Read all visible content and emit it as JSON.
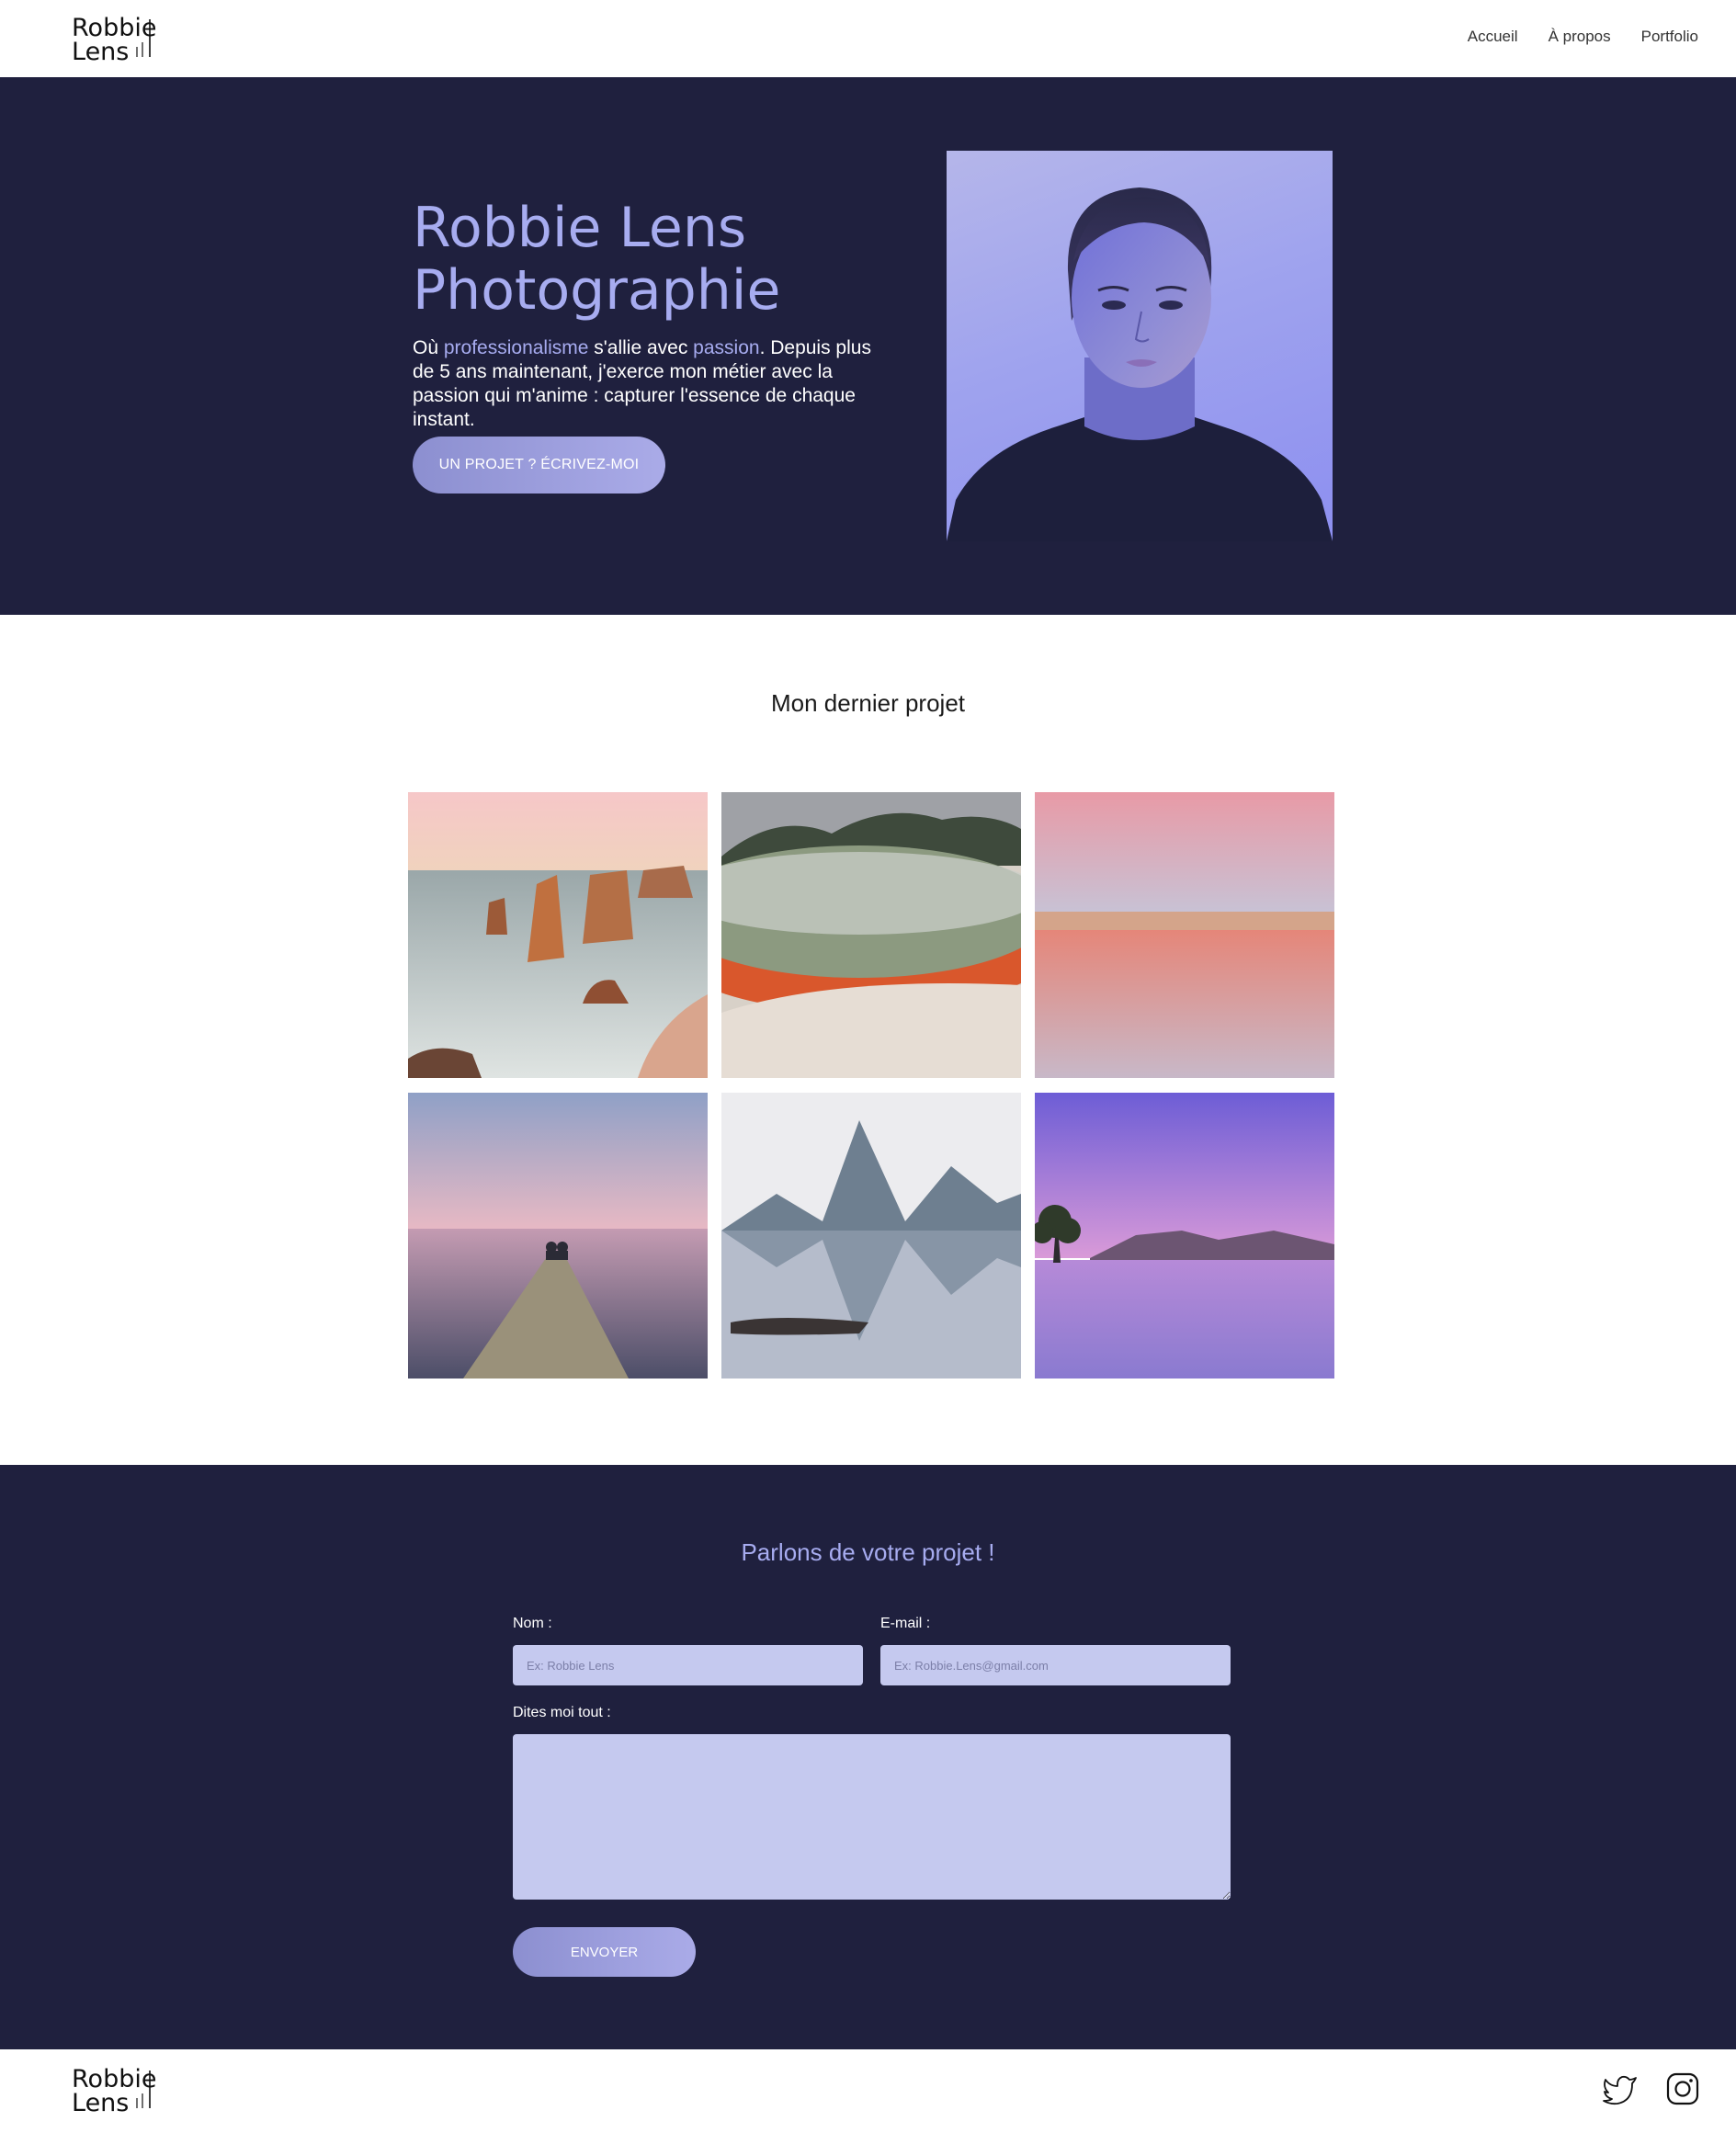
{
  "brand": {
    "line1": "Robbie",
    "line2": "Lens"
  },
  "nav": {
    "home": "Accueil",
    "about": "À propos",
    "portfolio": "Portfolio"
  },
  "hero": {
    "title_line1": "Robbie Lens",
    "title_line2": "Photographie",
    "text_1": "Où ",
    "text_accent_1": "professionalisme",
    "text_2": " s'allie avec ",
    "text_accent_2": "passion",
    "text_3": ". Depuis plus de 5 ans maintenant, j'exerce mon métier avec la passion qui m'anime : capturer l'essence de chaque instant.",
    "cta_label": "UN PROJET ? ÉCRIVEZ-MOI"
  },
  "project": {
    "title": "Mon dernier projet"
  },
  "contact": {
    "title": "Parlons de votre projet !",
    "name_label": "Nom :",
    "name_placeholder": "Ex: Robbie Lens",
    "email_label": "E-mail :",
    "email_placeholder": "Ex: Robbie.Lens@gmail.com",
    "message_label": "Dites moi tout :",
    "send_label": "ENVOYER"
  },
  "footer": {
    "twitter_icon": "twitter-icon",
    "instagram_icon": "instagram-icon"
  },
  "colors": {
    "navy": "#1f203e",
    "accent": "#a7acf0",
    "field": "#c5c9ef"
  }
}
